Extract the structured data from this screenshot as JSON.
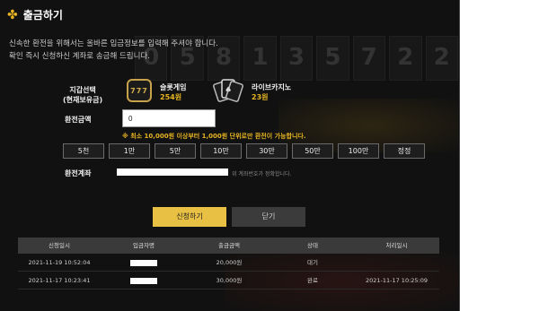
{
  "modal": {
    "title": "출금하기",
    "notice_line1": "신속한 환전을 위해서는 올바른 입금정보를 입력해 주셔야 합니다.",
    "notice_line2": "확인 즉시 신청하신 계좌로 송금해 드립니다."
  },
  "background_digits": [
    "0",
    "5",
    "8",
    "1",
    "3",
    "5",
    "7",
    "2",
    "2"
  ],
  "wallet": {
    "label_line1": "지갑선택",
    "label_line2": "(현재보유금)",
    "slot": {
      "icon_text": "777",
      "name": "슬롯게임",
      "amount": "254원"
    },
    "casino": {
      "name": "라이브카지노",
      "amount": "23원"
    }
  },
  "form": {
    "amount_label": "환전금액",
    "amount_value": "0",
    "warning": "※ 최소 10,000원 이상부터 1,000원 단위로만 환전이 가능합니다.",
    "account_label": "환전계좌",
    "account_hint": "위 계좌번호가 정확합니다."
  },
  "amount_buttons": [
    "5천",
    "1만",
    "5만",
    "10만",
    "30만",
    "50만",
    "100만",
    "정정"
  ],
  "actions": {
    "apply": "신청하기",
    "close": "닫기"
  },
  "table": {
    "headers": [
      "신청일시",
      "입금자명",
      "출금금액",
      "상태",
      "처리일시"
    ],
    "rows": [
      {
        "date": "2021-11-19 10:52:04",
        "amount": "20,000원",
        "status": "대기",
        "processed": ""
      },
      {
        "date": "2021-11-17 10:23:41",
        "amount": "30,000원",
        "status": "완료",
        "processed": "2021-11-17 10:25:09"
      }
    ]
  },
  "colors": {
    "accent": "#e8c043",
    "panel": "#111111",
    "header": "#3a3a3a"
  }
}
